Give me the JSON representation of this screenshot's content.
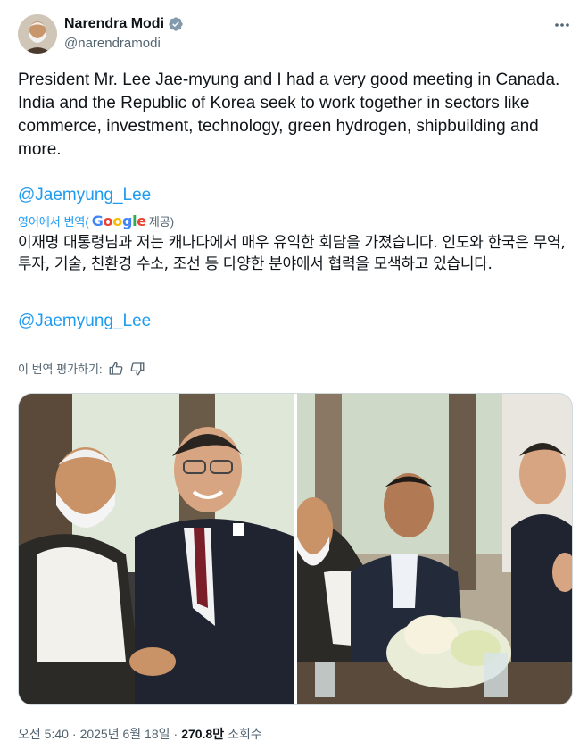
{
  "author": {
    "display_name": "Narendra Modi",
    "handle": "@narendramodi"
  },
  "tweet": {
    "text": "President Mr. Lee Jae-myung and I had a very good meeting in Canada. India and the Republic of Korea seek to work together in sectors like commerce, investment, technology, green hydrogen, shipbuilding and more.",
    "mention": "@Jaemyung_Lee"
  },
  "translation": {
    "from_label": "영어에서 번역(",
    "provider_logo": "Google",
    "provided_label": "제공)",
    "text": "이재명 대통령님과 저는 캐나다에서 매우 유익한 회담을 가졌습니다. 인도와 한국은 무역, 투자, 기술, 친환경 수소, 조선 등 다양한 분야에서 협력을 모색하고 있습니다.",
    "mention": "@Jaemyung_Lee",
    "rate_label": "이 번역 평가하기:"
  },
  "meta": {
    "time": "오전 5:40",
    "sep1": "·",
    "date": "2025년 6월 18일",
    "sep2": "·",
    "views": "270.8만",
    "views_label": "조회수"
  },
  "icons": {
    "verified": "verified-badge-icon",
    "more": "more-options-icon",
    "thumbs_up": "thumbs-up-icon",
    "thumbs_down": "thumbs-down-icon"
  },
  "colors": {
    "accent": "#1d9bf0",
    "text": "#0f1419",
    "secondary": "#536471"
  }
}
